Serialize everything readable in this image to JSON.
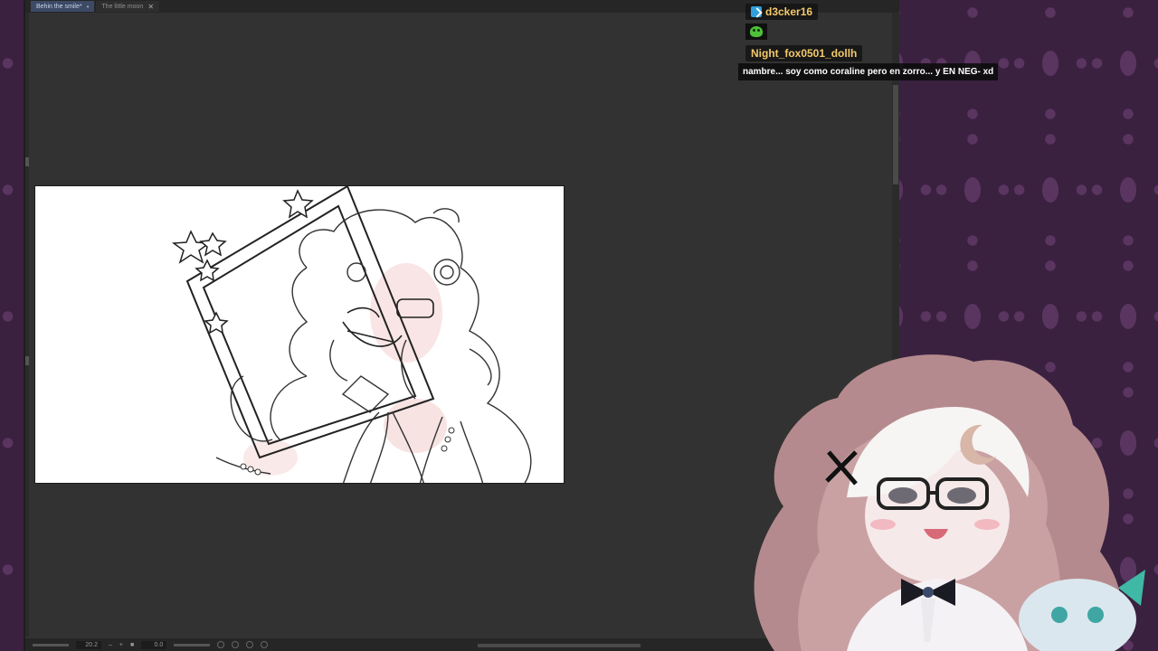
{
  "tabs": [
    {
      "label": "Behin the smile*",
      "active": true
    },
    {
      "label": "The little moon",
      "active": false
    }
  ],
  "statusbar": {
    "zoom": "20.2",
    "rotation": "0.0"
  },
  "chat": [
    {
      "username": "d3cker16",
      "badge": "checkmark-icon",
      "emote": "green-slime-emote",
      "text": ""
    },
    {
      "username": "Night_fox0501_dollh",
      "text": "nambre... soy como coraline pero en zorro... y EN NEG- xd"
    }
  ],
  "colors": {
    "username": "#f3c96a",
    "app_bg": "#323232",
    "wallpaper": "#3a2140"
  }
}
